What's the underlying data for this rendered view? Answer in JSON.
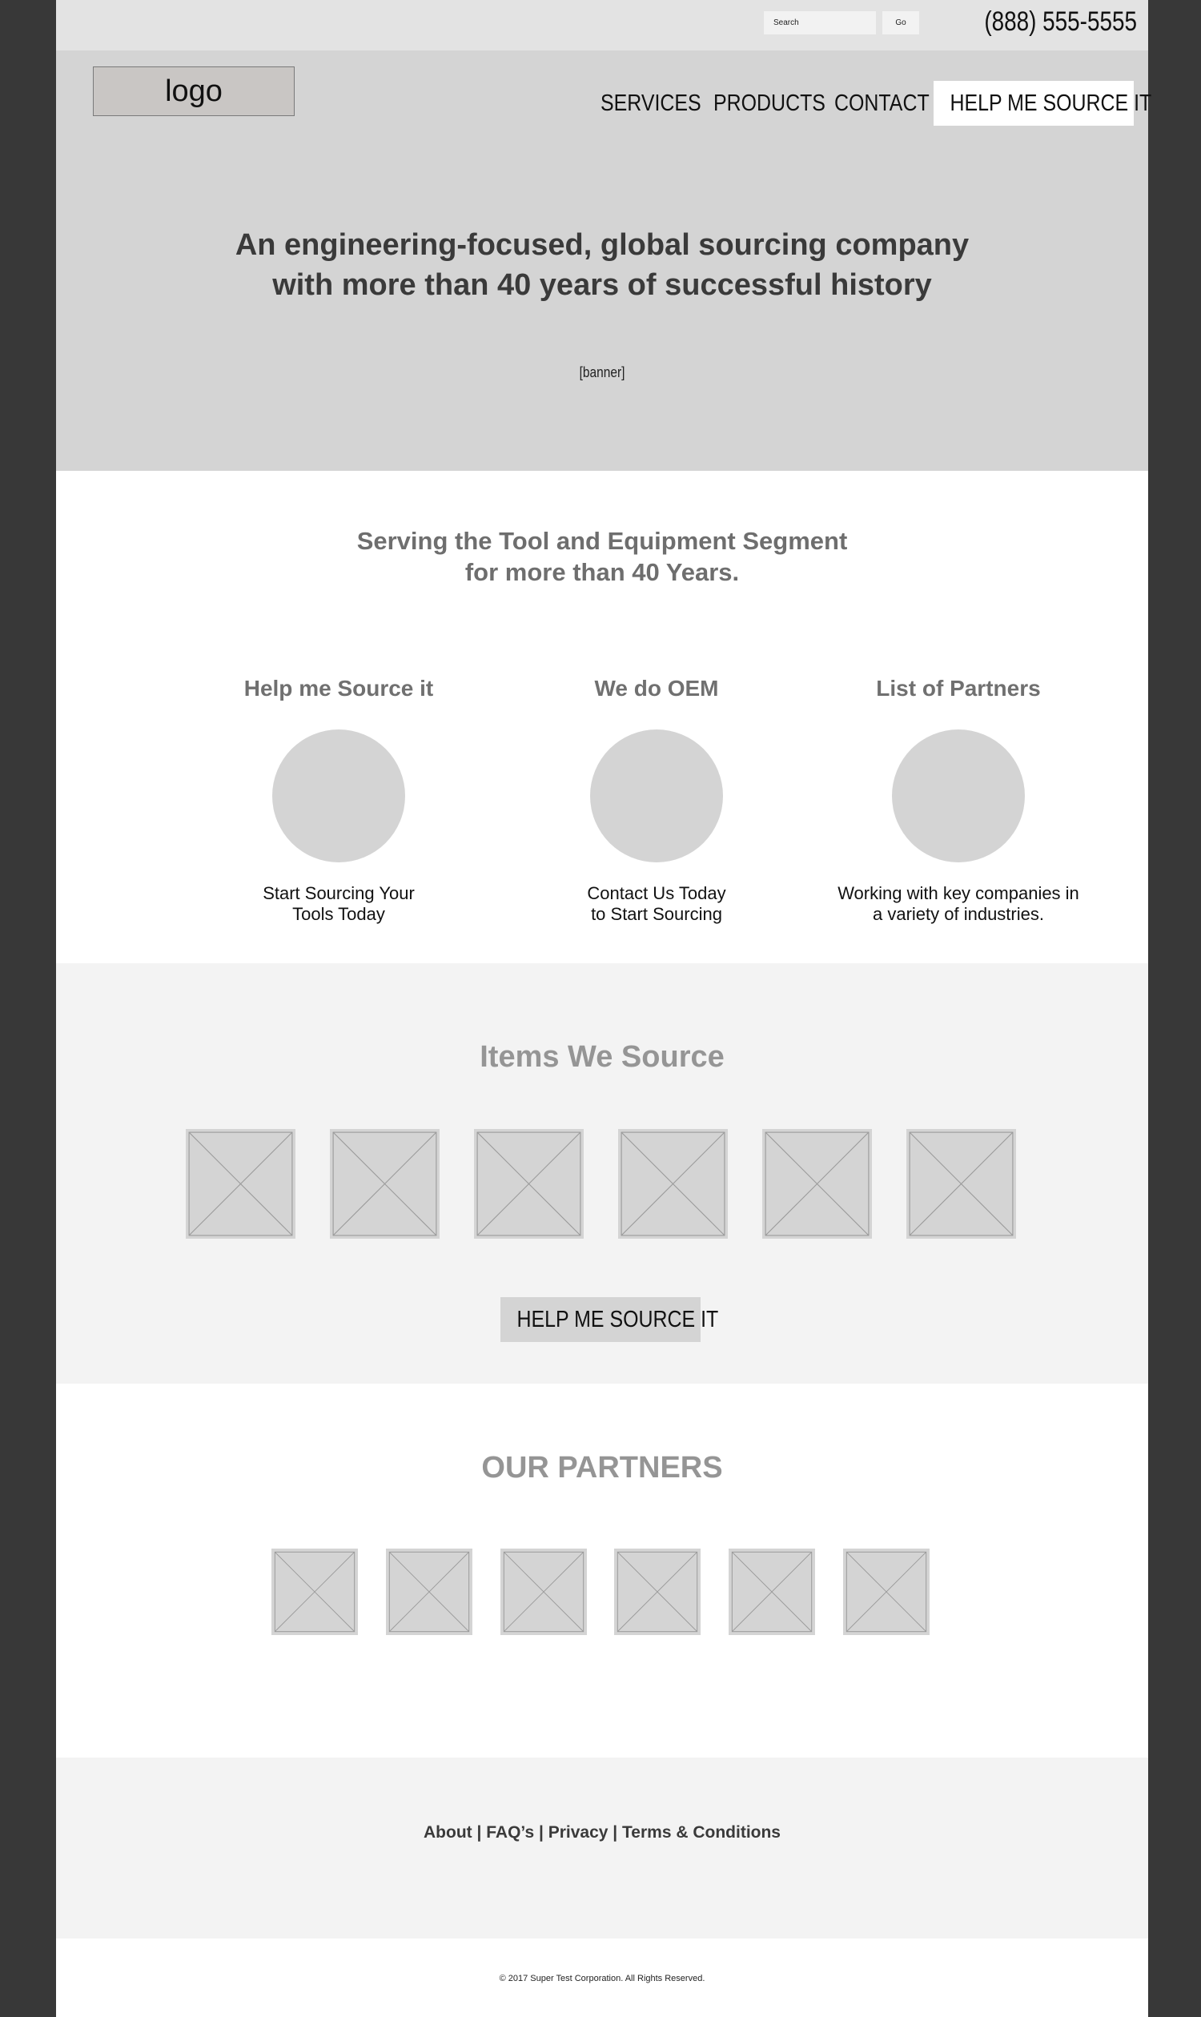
{
  "header": {
    "search": {
      "placeholder": "Search",
      "value": ""
    },
    "go_label": "Go",
    "phone": "(888) 555-5555"
  },
  "hero": {
    "logo_text": "logo",
    "nav": [
      {
        "label": "SERVICES"
      },
      {
        "label": "PRODUCTS"
      },
      {
        "label": "CONTACT"
      }
    ],
    "nav_cta": "HELP ME SOURCE IT",
    "title_line1": "An engineering-focused, global sourcing company",
    "title_line2": "with more than 40 years of successful history",
    "banner_label": "[banner]"
  },
  "serving": {
    "title_line1": "Serving the Tool and Equipment Segment",
    "title_line2": "for more than 40 Years.",
    "features": [
      {
        "title": "Help me Source it",
        "text_line1": "Start Sourcing Your",
        "text_line2": "Tools Today"
      },
      {
        "title": "We do OEM",
        "text_line1": "Contact Us Today",
        "text_line2": "to Start Sourcing"
      },
      {
        "title": "List of Partners",
        "text_line1": "Working with key companies in",
        "text_line2": "a variety of industries."
      }
    ]
  },
  "items": {
    "title": "Items We Source",
    "cta": "HELP ME SOURCE IT"
  },
  "partners": {
    "title": "OUR PARTNERS"
  },
  "footer": {
    "links": [
      "About",
      "FAQ’s",
      "Privacy",
      "Terms & Conditions"
    ],
    "separator": "|",
    "copyright": "© 2017 Super Test Corporation. All Rights Reserved."
  },
  "colors": {
    "outer_bg": "#383838",
    "topbar_bg": "#e3e3e3",
    "hero_bg": "#d4d4d4",
    "light_section_bg": "#f3f3f3",
    "heading_gray": "#959595",
    "placeholder_gray": "#d4d4d4"
  }
}
